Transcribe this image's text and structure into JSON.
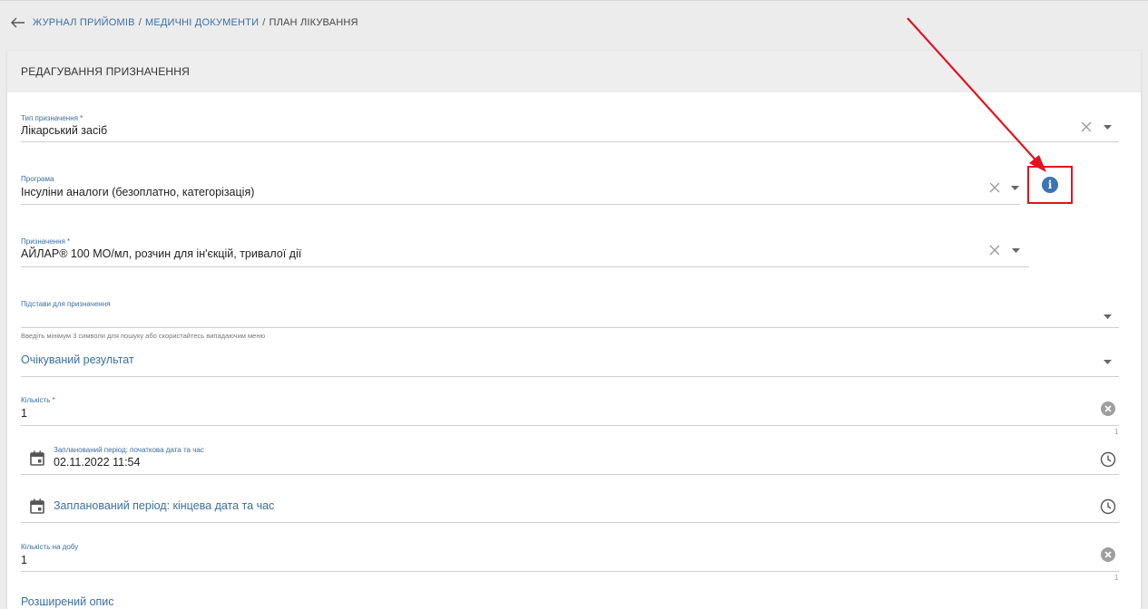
{
  "breadcrumb": {
    "link1": "ЖУРНАЛ ПРИЙОМІВ",
    "link2": "МЕДИЧНІ ДОКУМЕНТИ",
    "current": "ПЛАН ЛІКУВАННЯ",
    "separator": "/"
  },
  "card": {
    "title": "РЕДАГУВАННЯ ПРИЗНАЧЕННЯ"
  },
  "fields": {
    "type": {
      "label": "Тип призначення *",
      "value": "Лікарський засіб"
    },
    "program": {
      "label": "Програма",
      "value": "Інсуліни аналоги (безоплатно, категорізація)"
    },
    "prescription": {
      "label": "Призначення *",
      "value": "АЙЛАР® 100 МО/мл, розчин для ін'єкцій, тривалої дії"
    },
    "basis": {
      "label": "Підстави для призначення",
      "hint": "Введіть мінімум 3 символи для пошуку або скористайтесь випадаючим меню"
    },
    "expected_result": {
      "placeholder": "Очікуваний результат"
    },
    "quantity": {
      "label": "Кількість *",
      "value": "1",
      "counter": "1"
    },
    "start": {
      "label": "Запланований період: початкова дата та час",
      "value": "02.11.2022 11:54"
    },
    "end": {
      "placeholder": "Запланований період: кінцева дата та час"
    },
    "per_day": {
      "label": "Кількість на добу",
      "value": "1",
      "counter": "1"
    },
    "extended_description": {
      "label": "Розширений опис"
    }
  },
  "colors": {
    "accent": "#3b6fa3",
    "info_icon": "#3c74b8",
    "highlight": "#e0141f"
  },
  "icons": {
    "back": "arrow-left-icon",
    "clear": "close-icon",
    "dropdown": "chevron-down-icon",
    "info": "info-icon",
    "calendar": "calendar-icon",
    "clock": "clock-icon",
    "clear_filled": "clear-circle-icon"
  }
}
